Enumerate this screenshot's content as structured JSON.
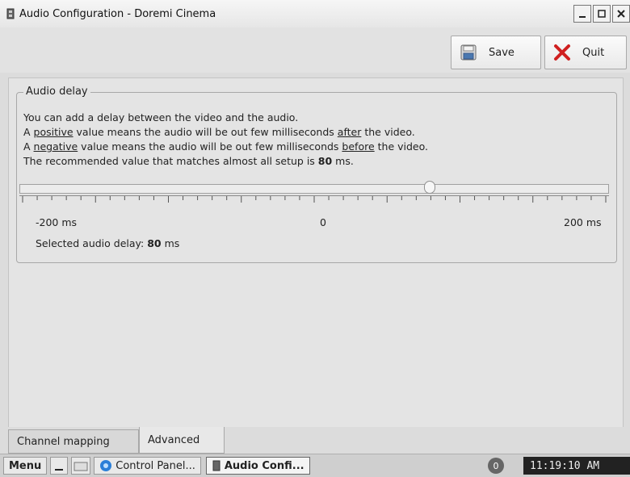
{
  "window": {
    "title": "Audio Configuration - Doremi Cinema",
    "icons": [
      "app-icon",
      "minimize-icon",
      "maximize-icon",
      "close-icon"
    ]
  },
  "toolbar": {
    "save_label": "Save",
    "quit_label": "Quit"
  },
  "audio_delay": {
    "legend": "Audio delay",
    "line1": "You can add a delay between the video and the audio.",
    "line2_a": "A ",
    "line2_u": "positive",
    "line2_b": " value means the audio will be out few milliseconds ",
    "line2_u2": "after",
    "line2_c": " the video.",
    "line3_a": "A ",
    "line3_u": "negative",
    "line3_b": " value means the audio will be out few milliseconds ",
    "line3_u2": "before",
    "line3_c": " the video.",
    "line4_a": "The recommended value that matches almost all setup is ",
    "line4_b": "80",
    "line4_c": " ms.",
    "slider": {
      "min": -200,
      "max": 200,
      "value": 80
    },
    "min_label": "-200 ms",
    "mid_label": "0",
    "max_label": "200 ms",
    "selected_prefix": "Selected audio delay:",
    "selected_value": "80",
    "selected_unit": "ms"
  },
  "tabs": [
    {
      "label": "Channel mapping",
      "active": false
    },
    {
      "label": "Advanced",
      "active": true
    }
  ],
  "taskbar": {
    "menu_label": "Menu",
    "items": [
      "Control Panel...",
      "Audio Confi..."
    ],
    "badge": "0",
    "clock": "11:19:10 AM"
  }
}
